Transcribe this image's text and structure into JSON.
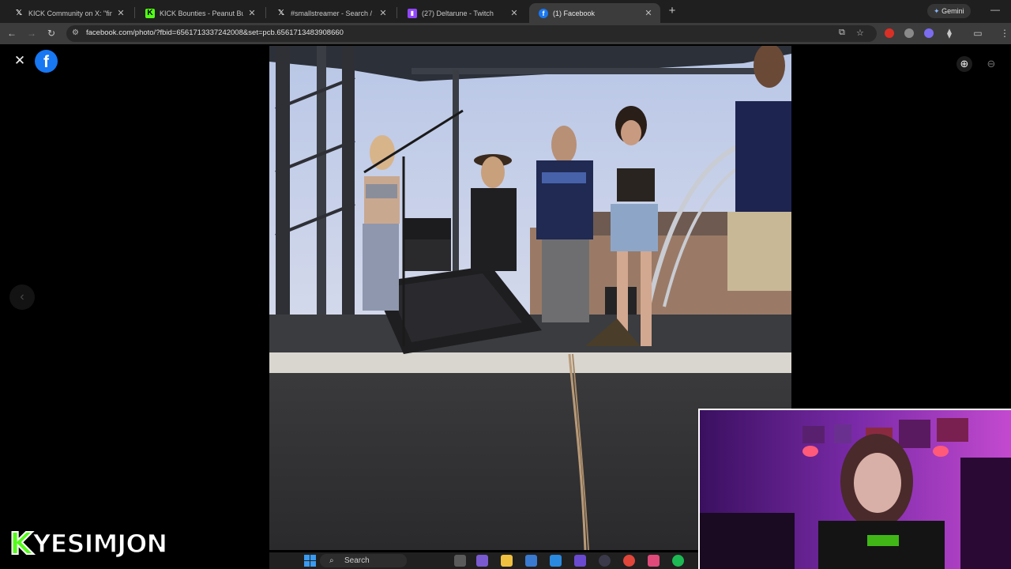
{
  "browser": {
    "tabs": [
      {
        "title": "KICK Community on X: \"find ou",
        "icon": "x-logo-icon",
        "active": false
      },
      {
        "title": "KICK Bounties - Peanut Butter W",
        "icon": "kick-logo-icon",
        "active": false
      },
      {
        "title": "#smallstreamer - Search / X",
        "icon": "x-logo-icon",
        "active": false
      },
      {
        "title": "(27) Deltarune - Twitch",
        "icon": "twitch-logo-icon",
        "active": false
      },
      {
        "title": "(1) Facebook",
        "icon": "facebook-logo-icon",
        "active": true
      }
    ],
    "new_tab": "+",
    "gemini_label": "Gemini",
    "url": "facebook.com/photo/?fbid=656171333724200​8&set=pcb.6561713483908660",
    "colors": {
      "tabbar": "#1f1f1f",
      "toolbar": "#3c3c3c",
      "omnibox": "#282828"
    }
  },
  "viewer": {
    "close_icon": "close-icon",
    "logo_letter": "f",
    "zoom_in_icon": "zoom-in-icon",
    "zoom_out_icon": "zoom-out-icon",
    "prev_icon": "chevron-left-icon",
    "colors": {
      "facebook_blue": "#1877f2"
    }
  },
  "overlay": {
    "brand_k": "K",
    "brand_name": "YESIMJON",
    "colors": {
      "kick_green": "#53fc18"
    }
  },
  "taskbar": {
    "search_label": "Search"
  }
}
